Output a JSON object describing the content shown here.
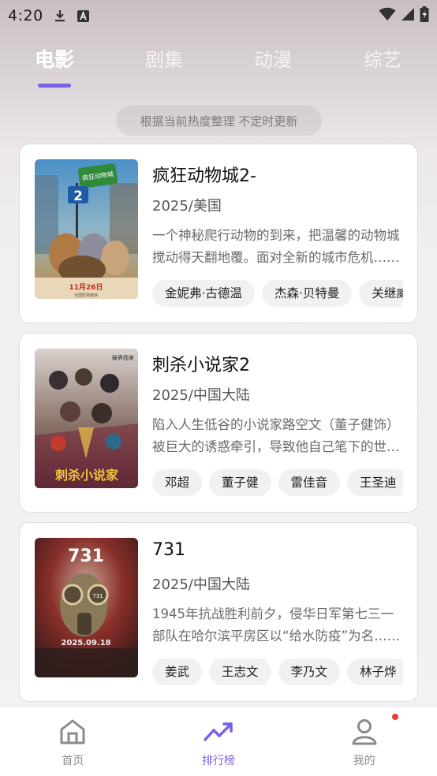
{
  "status": {
    "time": "4:20"
  },
  "tabs": [
    {
      "label": "电影"
    },
    {
      "label": "剧集"
    },
    {
      "label": "动漫"
    },
    {
      "label": "综艺"
    }
  ],
  "notice": "根据当前热度整理 不定时更新",
  "movies": [
    {
      "title": "疯狂动物城2-",
      "meta": "2025/美国",
      "desc": "一个神秘爬行动物的到来，把温馨的动物城搅动得天翻地覆。面对全新的城市危机……",
      "cast": [
        "金妮弗·古德温",
        "杰森·贝特曼",
        "关继威"
      ],
      "poster_text": [
        "疯狂动物城",
        "2",
        "11月26日",
        "全国影院献映"
      ]
    },
    {
      "title": "刺杀小说家2",
      "meta": "2025/中国大陆",
      "desc": "陷入人生低谷的小说家路空文（董子健饰）被巨大的诱惑牵引，导致他自己笔下的世界……",
      "cast": [
        "邓超",
        "董子健",
        "雷佳音",
        "王圣迪"
      ],
      "poster_text": [
        "刺杀小说家",
        "破界而来"
      ]
    },
    {
      "title": "731",
      "meta": "2025/中国大陆",
      "desc": "1945年抗战胜利前夕，侵华日军第七三一部队在哈尔滨平房区以“给水防疫”为名……",
      "cast": [
        "姜武",
        "王志文",
        "李乃文",
        "林子烨"
      ],
      "poster_text": [
        "731",
        "731",
        "2025.09.18"
      ]
    }
  ],
  "bottom_nav": [
    {
      "label": "首页",
      "icon": "home-icon"
    },
    {
      "label": "排行榜",
      "icon": "trending-icon"
    },
    {
      "label": "我的",
      "icon": "user-icon"
    }
  ],
  "colors": {
    "accent": "#7b5fe6",
    "badge": "#ee3b30"
  }
}
